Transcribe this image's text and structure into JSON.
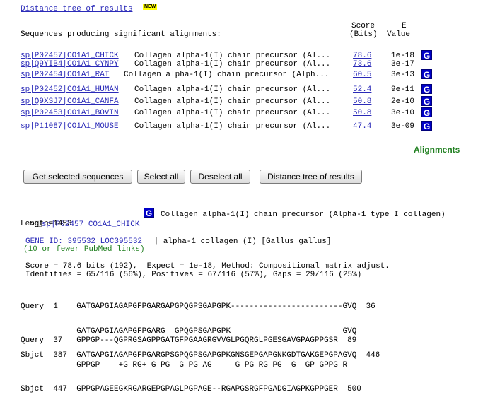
{
  "header": {
    "tree_link": "Distance tree of results",
    "new_badge": "NEW",
    "score_label_1": "Score",
    "score_label_2": "(Bits)",
    "evalue_label_1": "E",
    "evalue_label_2": "Value",
    "sequences_heading": "Sequences producing significant alignments:"
  },
  "hits": [
    {
      "accession": "sp|P02457|CO1A1_CHICK",
      "description": "Collagen alpha-1(I) chain precursor (Al...",
      "score": "78.6",
      "evalue": "1e-18",
      "gene_icon": "G"
    },
    {
      "accession": "sp|Q9YIB4|CO1A1_CYNPY",
      "description": "Collagen alpha-1(I) chain precursor (Al...",
      "score": "73.6",
      "evalue": "3e-17",
      "gene_icon": ""
    },
    {
      "accession": "sp|P02454|CO1A1_RAT",
      "description": "Collagen alpha-1(I) chain precursor (Alph...",
      "score": "60.5",
      "evalue": "3e-13",
      "gene_icon": "G"
    },
    {
      "accession": "sp|P02452|CO1A1_HUMAN",
      "description": "Collagen alpha-1(I) chain precursor (Al...",
      "score": "52.4",
      "evalue": "9e-11",
      "gene_icon": "G"
    },
    {
      "accession": "sp|Q9XSJ7|CO1A1_CANFA",
      "description": "Collagen alpha-1(I) chain precursor (Al...",
      "score": "50.8",
      "evalue": "2e-10",
      "gene_icon": "G"
    },
    {
      "accession": "sp|P02453|CO1A1_BOVIN",
      "description": "Collagen alpha-1(I) chain precursor (Al...",
      "score": "50.8",
      "evalue": "3e-10",
      "gene_icon": "G"
    },
    {
      "accession": "sp|P11087|CO1A1_MOUSE",
      "description": "Collagen alpha-1(I) chain precursor (Al...",
      "score": "47.4",
      "evalue": "3e-09",
      "gene_icon": "G"
    }
  ],
  "alignments_heading": "Alignments",
  "buttons": {
    "get_selected": "Get selected sequences",
    "select_all": "Select all",
    "deselect_all": "Deselect all",
    "distance_tree": "Distance tree of results"
  },
  "detail": {
    "marker": ">",
    "accession": "sp|P02457|CO1A1_CHICK",
    "gene_icon": "G",
    "title": "Collagen alpha-1(I) chain precursor (Alpha-1 type I collagen)",
    "length": "Length=1453",
    "gene_id_link": "GENE ID: 395532 LOC395532",
    "gene_desc": " | alpha-1 collagen (I) [Gallus gallus]",
    "pubmed_note": "(10 or fewer PubMed links)",
    "stats_line_1": "Score = 78.6 bits (192),  Expect = 1e-18, Method: Compositional matrix adjust.",
    "stats_line_2": "Identities = 65/116 (56%), Positives = 67/116 (57%), Gaps = 29/116 (25%)"
  },
  "alignment_blocks": [
    {
      "query": "Query  1    GATGAPGIAGAPGFPGARGAPGPQGPSGAPGPK------------------------GVQ  36",
      "match": "            GATGAPGIAGAPGFPGARG  GPQGPSGAPGPK                        GVQ",
      "sbjct": "Sbjct  387  GATGAPGIAGAPGFPGARGPSGPQGPSGAPGPKGNSGEPGAPGNKGDTGAKGEPGPAGVQ  446"
    },
    {
      "query": "Query  37   GPPGP---QGPRGSAGPPGATGFPGAAGRGVVGLPGQRGLPGESGAVGPAGPPGSR  89",
      "match": "            GPPGP    +G RG+ G PG  G PG AG     G PG RG PG  G  GP GPPG R",
      "sbjct": "Sbjct  447  GPPGPAGEEGKRGARGEPGPAGLPGPAGE--RGAPGSRGFPGADGIAGPKGPPGER  500"
    }
  ]
}
